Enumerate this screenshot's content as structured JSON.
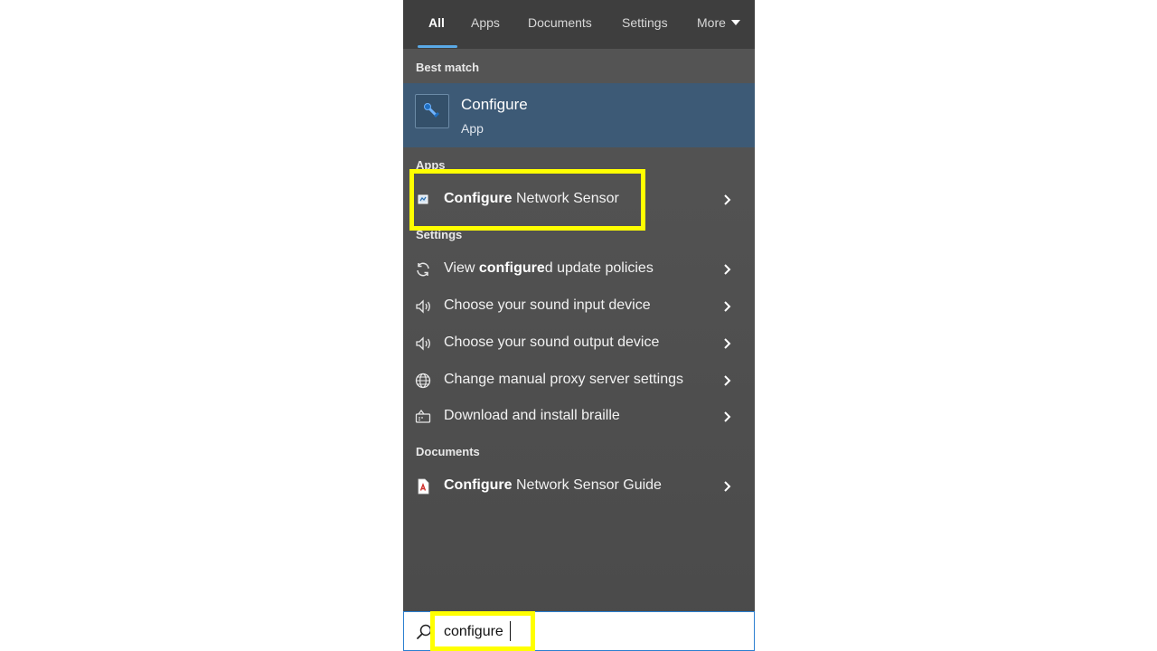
{
  "tabs": [
    {
      "label": "All",
      "active": true
    },
    {
      "label": "Apps"
    },
    {
      "label": "Documents"
    },
    {
      "label": "Settings"
    },
    {
      "label": "More"
    }
  ],
  "best_match": {
    "section_label": "Best match",
    "title": "Configure",
    "subtitle": "App"
  },
  "apps": {
    "section_label": "Apps",
    "items": [
      {
        "bold": "Configure",
        "rest": " Network Sensor"
      }
    ]
  },
  "settings": {
    "section_label": "Settings",
    "items": [
      {
        "pre": "View ",
        "bold": "configure",
        "rest": "d update policies",
        "icon": "sync-icon"
      },
      {
        "pre": "",
        "bold": "",
        "rest": "Choose your sound input device",
        "icon": "speaker-icon"
      },
      {
        "pre": "",
        "bold": "",
        "rest": "Choose your sound output device",
        "icon": "speaker-icon"
      },
      {
        "pre": "",
        "bold": "",
        "rest": "Change manual proxy server settings",
        "icon": "globe-icon"
      },
      {
        "pre": "",
        "bold": "",
        "rest": "Download and install braille",
        "icon": "braille-display-icon"
      }
    ]
  },
  "documents": {
    "section_label": "Documents",
    "items": [
      {
        "bold": "Configure",
        "rest": " Network Sensor Guide",
        "icon": "pdf-document-icon"
      }
    ]
  },
  "search": {
    "value": "configure"
  },
  "colors": {
    "panel_bg": "#505050",
    "tab_bar_bg": "#3e3e3e",
    "best_match_bg": "#3d5a76",
    "accent": "#5aa9e6",
    "highlight": "#ffff00"
  }
}
